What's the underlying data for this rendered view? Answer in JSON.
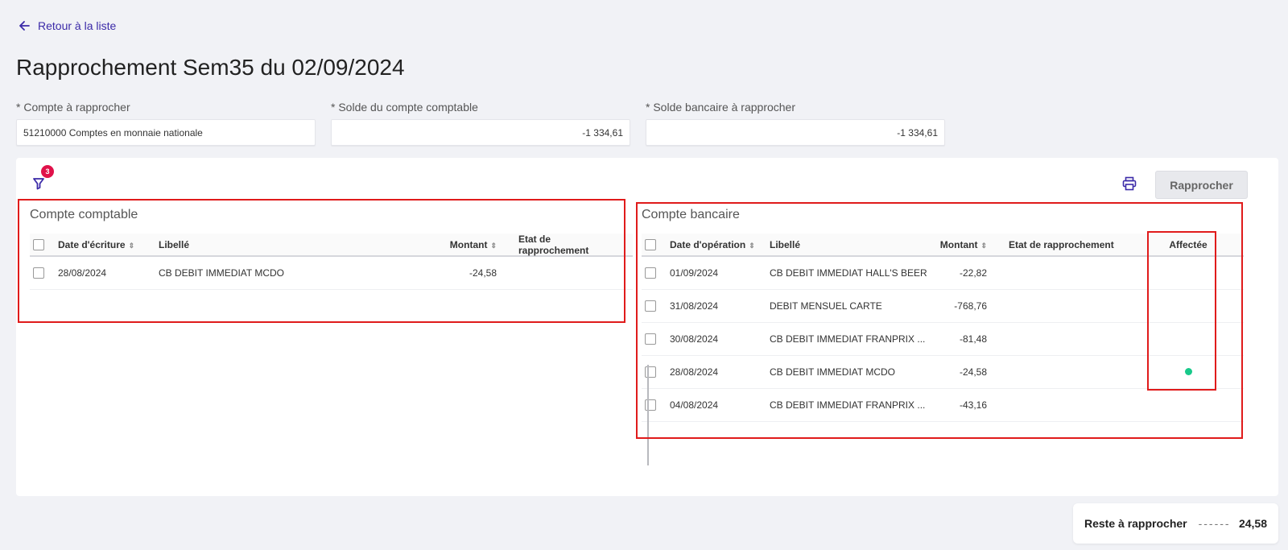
{
  "nav": {
    "back_label": "Retour à la liste"
  },
  "page": {
    "title": "Rapprochement Sem35 du 02/09/2024"
  },
  "fields": {
    "compte": {
      "label": "* Compte à rapprocher",
      "value": "51210000 Comptes en monnaie nationale"
    },
    "solde_comptable": {
      "label": "* Solde du compte comptable",
      "value": "-1 334,61"
    },
    "solde_bancaire": {
      "label": "* Solde bancaire à rapprocher",
      "value": "-1 334,61"
    }
  },
  "toolbar": {
    "filter_count": "3",
    "rapprocher_label": "Rapprocher"
  },
  "comptable": {
    "title": "Compte comptable",
    "columns": {
      "date": "Date d'écriture",
      "libelle": "Libellé",
      "montant": "Montant",
      "etat": "Etat de rapprochement"
    },
    "rows": [
      {
        "date": "28/08/2024",
        "libelle": "CB DEBIT IMMEDIAT MCDO",
        "montant": "-24,58",
        "etat": ""
      }
    ]
  },
  "bancaire": {
    "title": "Compte bancaire",
    "columns": {
      "date": "Date d'opération",
      "libelle": "Libellé",
      "montant": "Montant",
      "etat": "Etat de rapprochement",
      "affectee": "Affectée"
    },
    "rows": [
      {
        "date": "01/09/2024",
        "libelle": "CB DEBIT IMMEDIAT HALL'S BEER",
        "montant": "-22,82",
        "etat": "",
        "affectee": false
      },
      {
        "date": "31/08/2024",
        "libelle": "DEBIT MENSUEL CARTE",
        "montant": "-768,76",
        "etat": "",
        "affectee": false
      },
      {
        "date": "30/08/2024",
        "libelle": "CB DEBIT IMMEDIAT FRANPRIX ...",
        "montant": "-81,48",
        "etat": "",
        "affectee": false
      },
      {
        "date": "28/08/2024",
        "libelle": "CB DEBIT IMMEDIAT MCDO",
        "montant": "-24,58",
        "etat": "",
        "affectee": true
      },
      {
        "date": "04/08/2024",
        "libelle": "CB DEBIT IMMEDIAT FRANPRIX ...",
        "montant": "-43,16",
        "etat": "",
        "affectee": false
      }
    ]
  },
  "footer": {
    "reste_label": "Reste à rapprocher",
    "reste_value": "24,58"
  },
  "colors": {
    "accent": "#3b2aa8",
    "badge": "#e0114a",
    "assigned": "#18c98a",
    "highlight": "#e01b1b"
  }
}
